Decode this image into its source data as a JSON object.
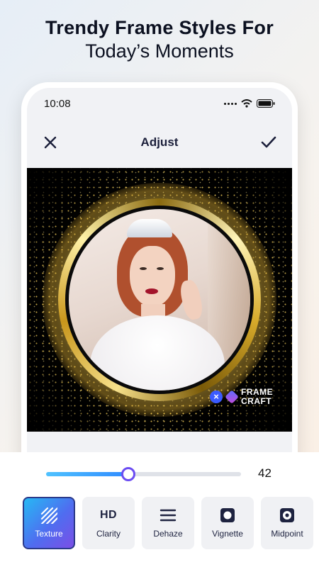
{
  "headline": {
    "line1": "Trendy Frame Styles For",
    "line2": "Today’s Moments"
  },
  "status_bar": {
    "time": "10:08"
  },
  "app_bar": {
    "title": "Adjust"
  },
  "watermark": {
    "line1": "FRAME",
    "line2": "CRAFT"
  },
  "slider": {
    "value": 42,
    "value_text": "42",
    "min": 0,
    "max": 100,
    "fraction": 0.42
  },
  "tools": [
    {
      "label": "Texture",
      "icon": "texture-icon",
      "active": true
    },
    {
      "label": "Clarity",
      "icon": "hd-icon",
      "icon_text": "HD",
      "active": false
    },
    {
      "label": "Dehaze",
      "icon": "dehaze-icon",
      "active": false
    },
    {
      "label": "Vignette",
      "icon": "vignette-icon",
      "active": false
    },
    {
      "label": "Midpoint",
      "icon": "midpoint-icon",
      "active": false
    }
  ],
  "colors": {
    "accent": "#6b4cf2",
    "slider_fill": "#2f8bff",
    "active_tool_start": "#26b9f4",
    "active_tool_end": "#7b4fe6",
    "frame_gold": "#d6a92a"
  }
}
